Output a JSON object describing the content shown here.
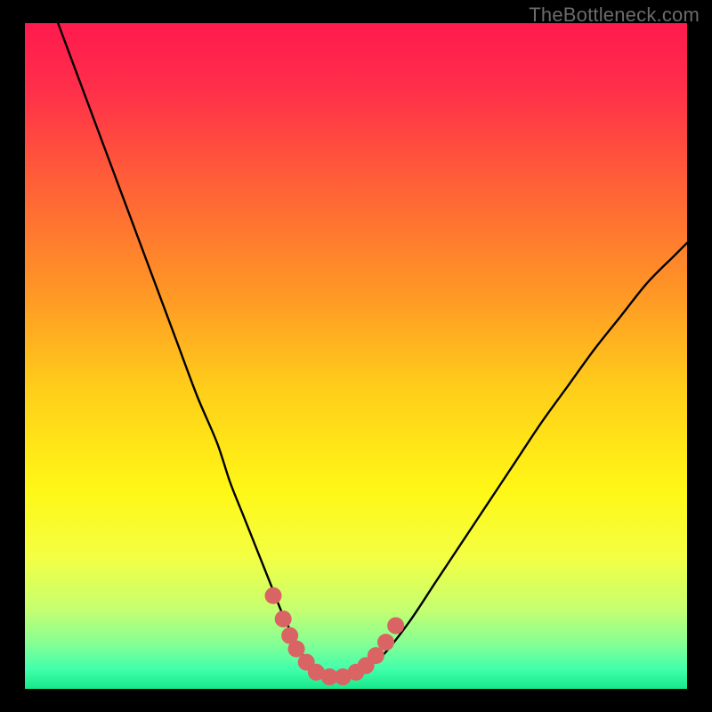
{
  "watermark": "TheBottleneck.com",
  "colors": {
    "page_bg": "#000000",
    "curve_stroke": "#000000",
    "marker_fill": "#da6464",
    "gradient_stops": [
      {
        "offset": 0.0,
        "color": "#ff1a4e"
      },
      {
        "offset": 0.1,
        "color": "#ff2f4a"
      },
      {
        "offset": 0.25,
        "color": "#ff6336"
      },
      {
        "offset": 0.4,
        "color": "#ff9526"
      },
      {
        "offset": 0.55,
        "color": "#ffce1a"
      },
      {
        "offset": 0.7,
        "color": "#fff716"
      },
      {
        "offset": 0.8,
        "color": "#f4ff42"
      },
      {
        "offset": 0.88,
        "color": "#c6ff70"
      },
      {
        "offset": 0.93,
        "color": "#88ff93"
      },
      {
        "offset": 0.97,
        "color": "#42ffab"
      },
      {
        "offset": 1.0,
        "color": "#17e88a"
      }
    ]
  },
  "chart_data": {
    "type": "line",
    "title": "",
    "xlabel": "",
    "ylabel": "",
    "x_range": [
      0,
      100
    ],
    "y_range": [
      0,
      100
    ],
    "grid": false,
    "legend": false,
    "series": [
      {
        "name": "bottleneck-curve",
        "x": [
          5,
          8,
          11,
          14,
          17,
          20,
          23,
          26,
          29,
          31,
          33,
          35,
          37,
          39,
          40.5,
          42,
          43.5,
          45,
          47,
          49,
          51,
          54,
          58,
          62,
          66,
          70,
          74,
          78,
          82,
          86,
          90,
          94,
          98,
          100
        ],
        "y": [
          100,
          92,
          84,
          76,
          68,
          60,
          52,
          44,
          37,
          31,
          26,
          21,
          16,
          11,
          8,
          5,
          3,
          2,
          1.5,
          2,
          3,
          5,
          10,
          16,
          22,
          28,
          34,
          40,
          45.5,
          51,
          56,
          61,
          65,
          67
        ]
      }
    ],
    "markers": [
      {
        "series": "bottleneck-curve",
        "points": [
          {
            "x": 37.5,
            "y": 14
          },
          {
            "x": 39.0,
            "y": 10.5
          },
          {
            "x": 40.0,
            "y": 8
          },
          {
            "x": 41.0,
            "y": 6
          },
          {
            "x": 42.5,
            "y": 4
          },
          {
            "x": 44.0,
            "y": 2.5
          },
          {
            "x": 46.0,
            "y": 1.8
          },
          {
            "x": 48.0,
            "y": 1.8
          },
          {
            "x": 50.0,
            "y": 2.5
          },
          {
            "x": 51.5,
            "y": 3.5
          },
          {
            "x": 53.0,
            "y": 5
          },
          {
            "x": 54.5,
            "y": 7
          },
          {
            "x": 56.0,
            "y": 9.5
          }
        ]
      }
    ]
  }
}
